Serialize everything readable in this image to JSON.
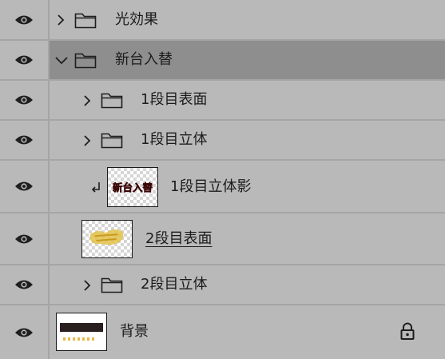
{
  "layers": [
    {
      "name": "光効果",
      "type": "group",
      "expanded": false
    },
    {
      "name": "新台入替",
      "type": "group",
      "expanded": true,
      "selected": true
    },
    {
      "name": "1段目表面",
      "type": "group",
      "expanded": false
    },
    {
      "name": "1段目立体",
      "type": "group",
      "expanded": false
    },
    {
      "name": "1段目立体影",
      "type": "layer",
      "clipped": true,
      "thumb_text": "新台入替"
    },
    {
      "name": "2段目表面",
      "type": "layer",
      "underlined": true
    },
    {
      "name": "2段目立体",
      "type": "group",
      "expanded": false
    },
    {
      "name": "背景",
      "type": "layer",
      "locked": true
    }
  ],
  "colors": {
    "panel_bg": "#b9b9b9",
    "selected_bg": "#8e8e8e",
    "divider": "#a5a5a5",
    "icon": "#1e1e1e",
    "shadow_text": "#6b0f0f",
    "gold": "#e3c24a"
  }
}
